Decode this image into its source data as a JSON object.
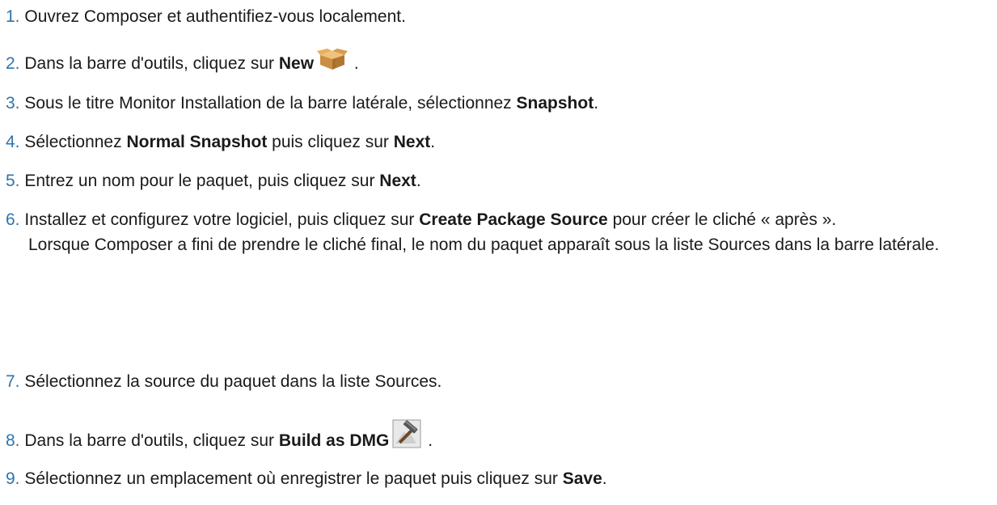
{
  "steps": [
    {
      "num": "1.",
      "text": "Ouvrez Composer et authentifiez-vous localement."
    },
    {
      "num": "2.",
      "pre": "Dans la barre d'outils, cliquez sur ",
      "bold": "New",
      "post": " ."
    },
    {
      "num": "3.",
      "pre": "Sous le titre Monitor Installation de la barre latérale, sélectionnez ",
      "bold": "Snapshot",
      "post": "."
    },
    {
      "num": "4.",
      "pre": "Sélectionnez ",
      "bold": "Normal Snapshot",
      "mid": " puis cliquez sur ",
      "bold2": "Next",
      "post": "."
    },
    {
      "num": "5.",
      "pre": "Entrez un nom pour le paquet, puis cliquez sur ",
      "bold": "Next",
      "post": "."
    },
    {
      "num": "6.",
      "pre": "Installez et configurez votre logiciel, puis cliquez sur ",
      "bold": "Create Package Source",
      "post": " pour créer le cliché « après ».",
      "sub": "Lorsque Composer a fini de prendre le cliché final, le nom du paquet apparaît sous la liste Sources dans la barre latérale."
    },
    {
      "num": "7.",
      "text": "Sélectionnez la source du paquet dans la liste Sources."
    },
    {
      "num": "8.",
      "pre": "Dans la barre d'outils, cliquez sur ",
      "bold": "Build as DMG",
      "post": " ."
    },
    {
      "num": "9.",
      "pre": "Sélectionnez un emplacement où enregistrer le paquet puis cliquez sur ",
      "bold": "Save",
      "post": "."
    }
  ],
  "icons": {
    "new": "package-box-icon",
    "build": "hammer-icon"
  }
}
